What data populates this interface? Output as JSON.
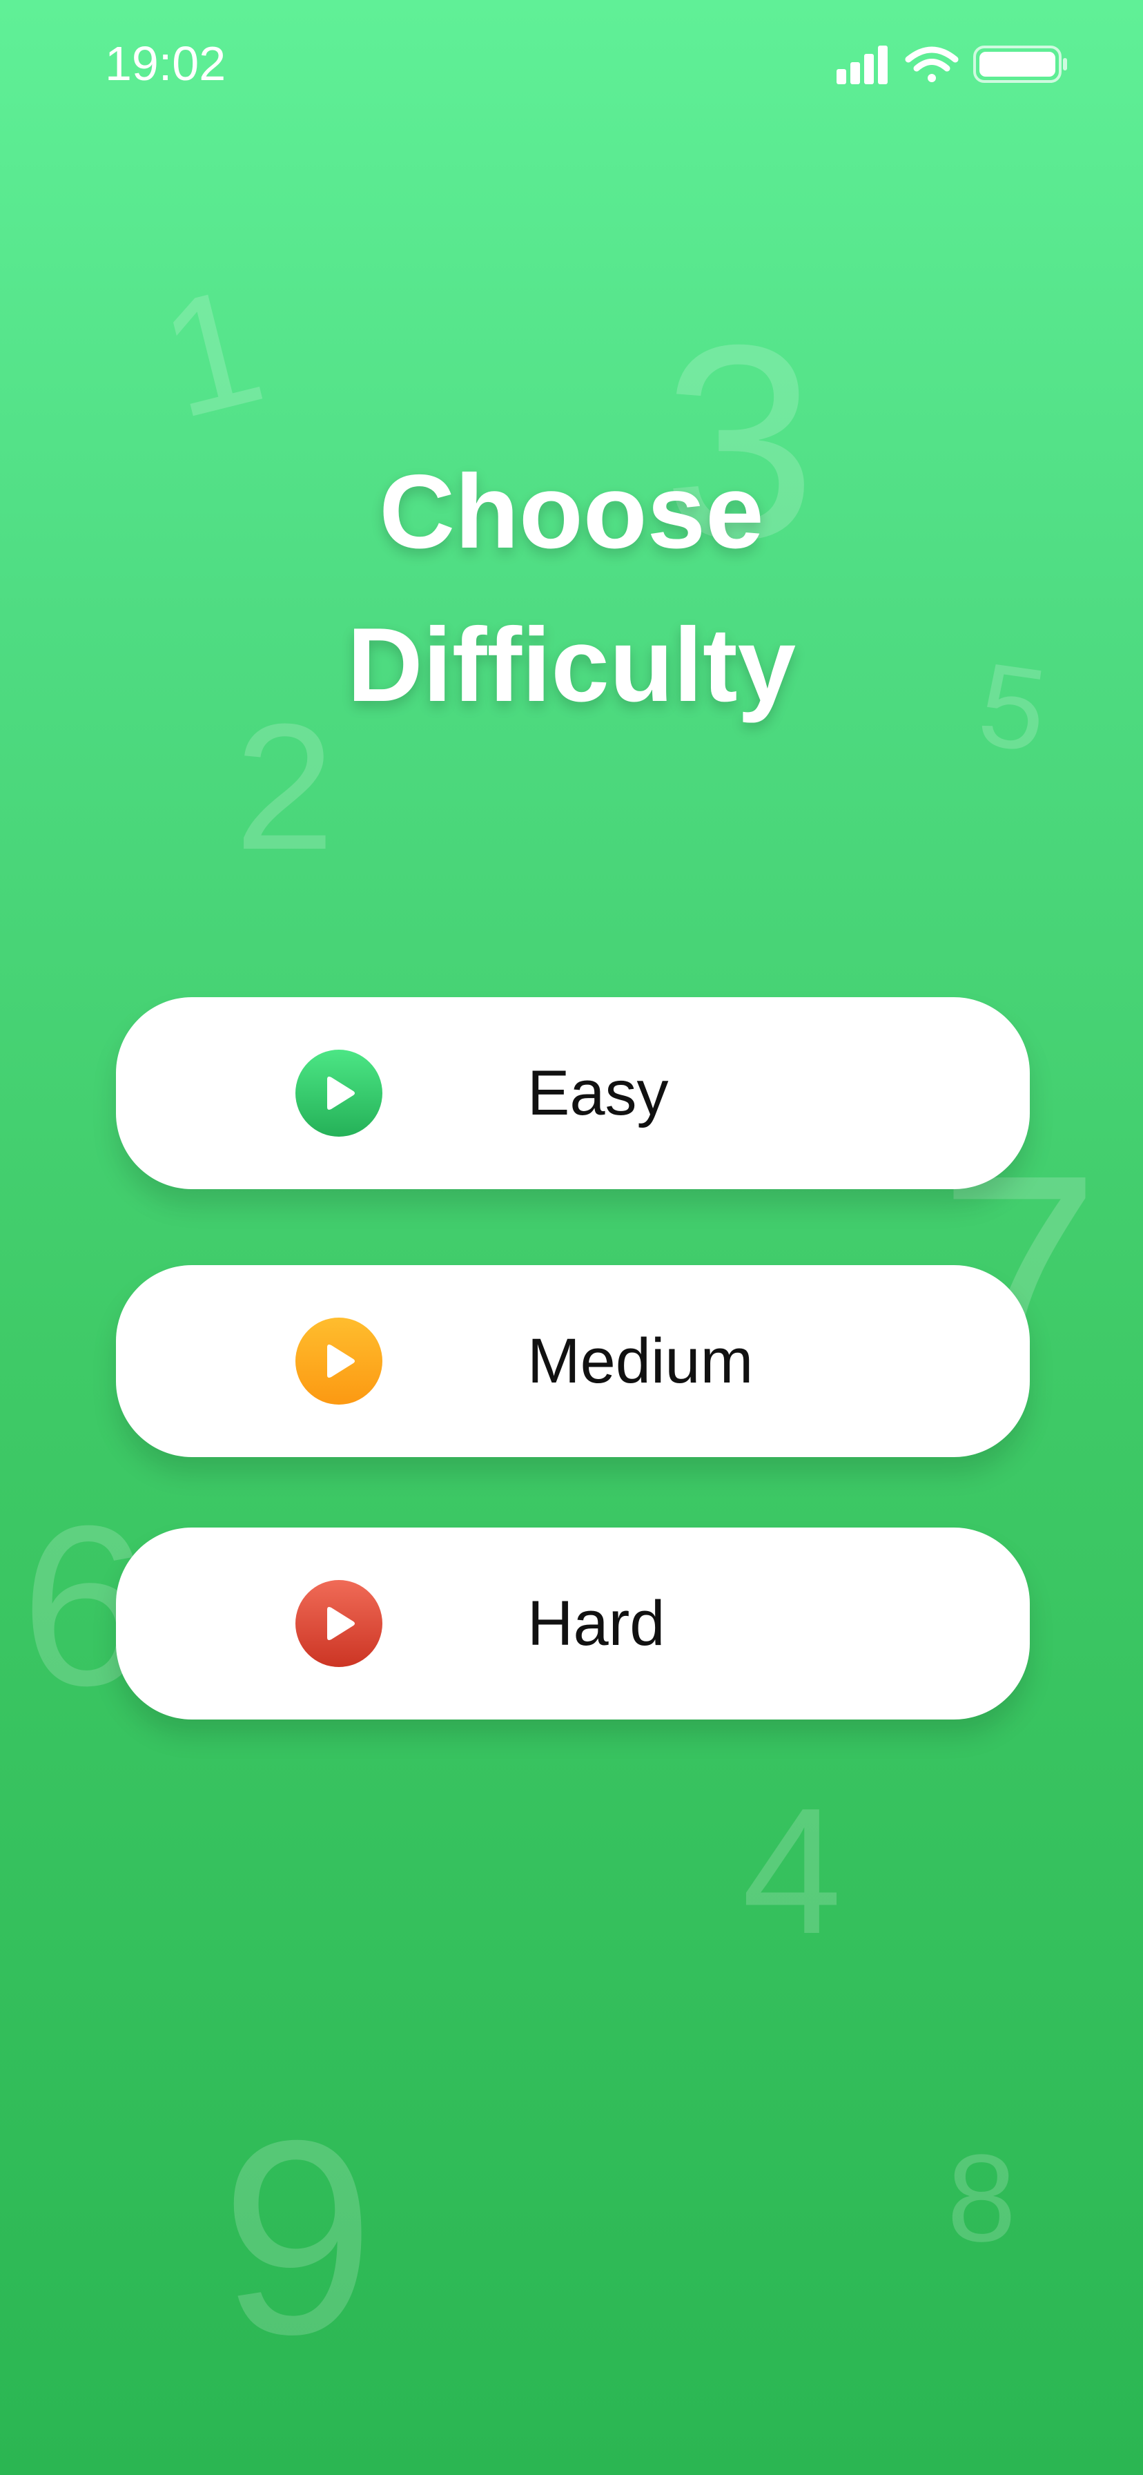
{
  "status_bar": {
    "time": "19:02",
    "icons": [
      "cellular-signal-icon",
      "wifi-icon",
      "battery-icon"
    ]
  },
  "title": {
    "line1": "Choose",
    "line2": "Difficulty"
  },
  "background_digits": [
    "1",
    "3",
    "5",
    "2",
    "7",
    "6",
    "4",
    "9",
    "8"
  ],
  "difficulties": [
    {
      "label": "Easy",
      "icon": "play-icon",
      "color": "#2fc264"
    },
    {
      "label": "Medium",
      "icon": "play-icon",
      "color": "#ffa81e"
    },
    {
      "label": "Hard",
      "icon": "play-icon",
      "color": "#d8402e"
    }
  ],
  "colors": {
    "background_top": "#60f097",
    "background_bottom": "#2bb652",
    "button_background": "#ffffff",
    "label_text": "#111111"
  }
}
